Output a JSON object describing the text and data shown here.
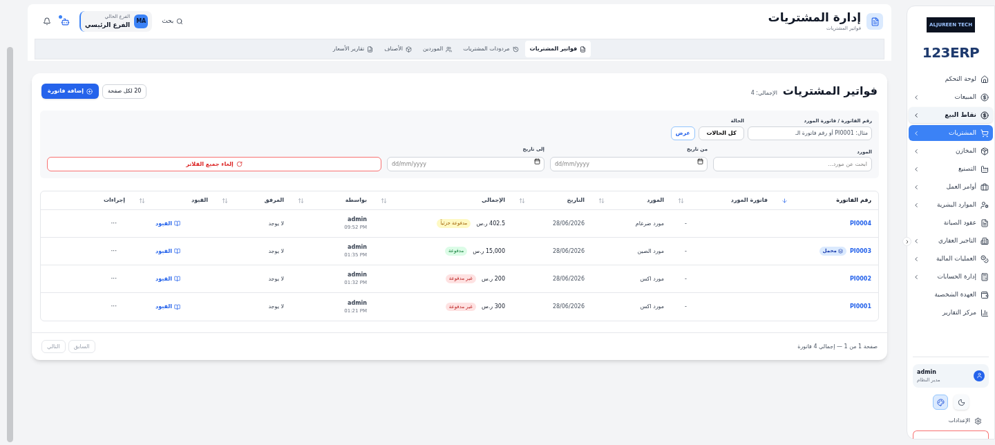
{
  "sidebar": {
    "company_logo": "ALJUREEN TECH",
    "app_logo": "123ERP",
    "items": [
      {
        "label": "لوحة التحكم",
        "has_children": false,
        "selected": false,
        "highlighted": false
      },
      {
        "label": "المبيعات",
        "has_children": true,
        "selected": false,
        "highlighted": false
      },
      {
        "label": "نقاط البيع",
        "has_children": true,
        "selected": false,
        "highlighted": true
      },
      {
        "label": "المشتريات",
        "has_children": true,
        "selected": true,
        "highlighted": false
      },
      {
        "label": "المخازن",
        "has_children": true,
        "selected": false,
        "highlighted": false
      },
      {
        "label": "التصنيع",
        "has_children": true,
        "selected": false,
        "highlighted": false
      },
      {
        "label": "أوامر العمل",
        "has_children": true,
        "selected": false,
        "highlighted": false
      },
      {
        "label": "الموارد البشرية",
        "has_children": true,
        "selected": false,
        "highlighted": false
      },
      {
        "label": "عقود الصيانة",
        "has_children": false,
        "selected": false,
        "highlighted": false
      },
      {
        "label": "التاجير العقاري",
        "has_children": true,
        "selected": false,
        "highlighted": false
      },
      {
        "label": "العمليات المالية",
        "has_children": true,
        "selected": false,
        "highlighted": false
      },
      {
        "label": "إدارة الحسابات",
        "has_children": true,
        "selected": false,
        "highlighted": false
      },
      {
        "label": "العهدة الشخصية",
        "has_children": false,
        "selected": false,
        "highlighted": false
      },
      {
        "label": "مركز التقارير",
        "has_children": false,
        "selected": false,
        "highlighted": false
      }
    ],
    "user": {
      "name": "admin",
      "role": "مدير النظام"
    },
    "theme_buttons": [
      {
        "kind": "dark",
        "selected": false
      },
      {
        "kind": "palette",
        "selected": true
      }
    ],
    "settings": "الإعدادات"
  },
  "header": {
    "title": "إدارة المشتريات",
    "subtitle": "فواتير المشتريات",
    "search": "بحث",
    "branch_label": "الفرع الحالي",
    "branch": "الفرع الرئيسي",
    "avatar": "MA",
    "assistant_notification": true
  },
  "tabs": [
    {
      "label": "فواتير المشتريات",
      "selected": true
    },
    {
      "label": "مردودات المشتريات",
      "selected": false
    },
    {
      "label": "الموردين",
      "selected": false
    },
    {
      "label": "الأصناف",
      "selected": false
    },
    {
      "label": "تقارير الأسعار",
      "selected": false
    }
  ],
  "card": {
    "title": "فواتير المشتريات",
    "total": "الإجمالي: 4",
    "per_page": "20 لكل صفحة",
    "add_button": "إضافة فاتورة"
  },
  "filters": {
    "invoice_label": "رقم الفاتورة / فاتورة المورد",
    "invoice_placeholder": "مثال: PI0001 أو رقم فاتورة الـ",
    "status_label": "الحالة",
    "status_value": "كل الحالات",
    "show_button": "عرض",
    "supplier_label": "المورد",
    "supplier_placeholder": "ابحث عن مورد...",
    "from_label": "من تاريخ",
    "from_placeholder": "dd/mm/yyyy",
    "to_label": "إلى تاريخ",
    "to_placeholder": "dd/mm/yyyy",
    "clear_button": "إلغاء جميع الفلاتر"
  },
  "table": {
    "columns": [
      {
        "label": "رقم الفاتورة",
        "sortable": true,
        "sorted": true
      },
      {
        "label": "فاتورة المورد",
        "sortable": true,
        "sorted": false
      },
      {
        "label": "المورد",
        "sortable": true,
        "sorted": false
      },
      {
        "label": "التاريخ",
        "sortable": true,
        "sorted": false
      },
      {
        "label": "الإجمالي",
        "sortable": true,
        "sorted": false
      },
      {
        "label": "بواسطة",
        "sortable": true,
        "sorted": false
      },
      {
        "label": "المرفق",
        "sortable": true,
        "sorted": false
      },
      {
        "label": "القيود",
        "sortable": true,
        "sorted": false
      },
      {
        "label": "إجراءات",
        "sortable": false,
        "sorted": false
      }
    ],
    "rows": [
      {
        "invoice": "PI0004",
        "tag": null,
        "supplier_invoice": "-",
        "supplier": "مورد ضرغام",
        "date": "28/06/2026",
        "amount": "402.5 ر.س",
        "status": {
          "kind": "partial",
          "label": "مدفوعة جزئياً"
        },
        "by": "admin",
        "time": "09:52 PM",
        "attachment": "لا يوجد",
        "entries": "القيود",
        "actions": "···"
      },
      {
        "invoice": "PI0003",
        "tag": "محمل",
        "supplier_invoice": "-",
        "supplier": "مورد الصين",
        "date": "28/06/2026",
        "amount": "15,000 ر.س",
        "status": {
          "kind": "paid",
          "label": "مدفوعة"
        },
        "by": "admin",
        "time": "01:35 PM",
        "attachment": "لا يوجد",
        "entries": "القيود",
        "actions": "···"
      },
      {
        "invoice": "PI0002",
        "tag": null,
        "supplier_invoice": "-",
        "supplier": "مورد اكس",
        "date": "28/06/2026",
        "amount": "200 ر.س",
        "status": {
          "kind": "unpaid",
          "label": "غير مدفوعة"
        },
        "by": "admin",
        "time": "01:32 PM",
        "attachment": "لا يوجد",
        "entries": "القيود",
        "actions": "···"
      },
      {
        "invoice": "PI0001",
        "tag": null,
        "supplier_invoice": "-",
        "supplier": "مورد اكس",
        "date": "28/06/2026",
        "amount": "300 ر.س",
        "status": {
          "kind": "unpaid",
          "label": "غير مدفوعة"
        },
        "by": "admin",
        "time": "01:21 PM",
        "attachment": "لا يوجد",
        "entries": "القيود",
        "actions": "···"
      }
    ]
  },
  "pagination": {
    "summary": "صفحة 1 من 1 — إجمالي 4 فاتورة",
    "buttons": [
      {
        "label": "السابق",
        "disabled": true
      },
      {
        "label": "التالي",
        "disabled": true
      }
    ]
  }
}
